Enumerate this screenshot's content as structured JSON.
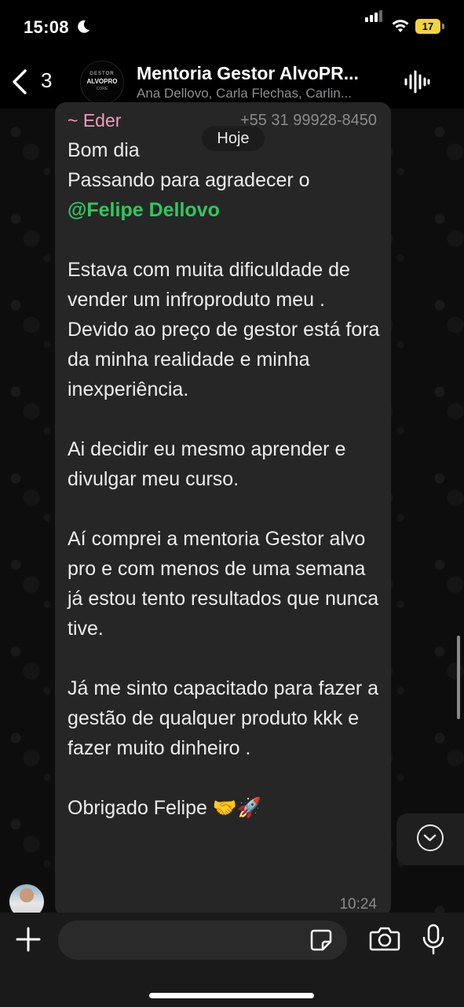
{
  "status_bar": {
    "time": "15:08",
    "battery": "17"
  },
  "header": {
    "back_count": "3",
    "title": "Mentoria Gestor AlvoPR...",
    "members": "Ana Dellovo, Carla Flechas, Carlin...",
    "avatar_line1": "GESTOR",
    "avatar_line2": "ALVOPRO",
    "avatar_line3": "CORE"
  },
  "chat": {
    "day_label": "Hoje",
    "message": {
      "sender": "~ Eder",
      "phone": "+55 31 99928-8450",
      "text_before": "Bom dia\nPassando para agradecer o\n",
      "mention": "@Felipe Dellovo",
      "text_after": "\n\nEstava com muita dificuldade de vender um infroproduto meu . Devido ao preço de gestor está fora da minha realidade e minha inexperiência.\n\nAi decidir eu mesmo aprender e divulgar meu curso.\n\nAí comprei a mentoria Gestor alvo pro e com menos de uma semana já estou tento resultados que nunca tive.\n\nJá me sinto capacitado para fazer a gestão de qualquer produto kkk e  fazer muito dinheiro .\n\nObrigado Felipe 🤝🚀",
      "time": "10:24"
    }
  },
  "composer": {
    "placeholder": ""
  },
  "colors": {
    "mention": "#2fc85e",
    "sender": "#f59ac2",
    "bubble": "#262626"
  }
}
